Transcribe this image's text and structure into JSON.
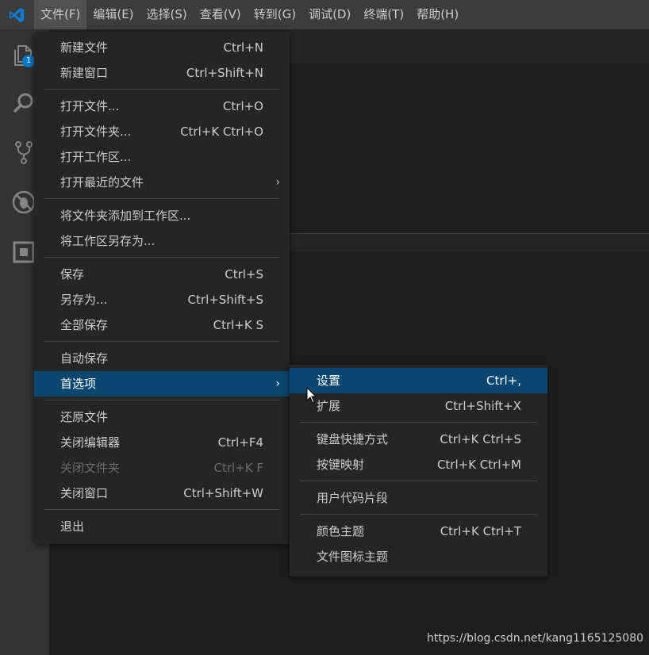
{
  "menubar": {
    "items": [
      "文件(F)",
      "编辑(E)",
      "选择(S)",
      "查看(V)",
      "转到(G)",
      "调试(D)",
      "终端(T)",
      "帮助(H)"
    ],
    "active_index": 0
  },
  "activitybar": {
    "icons": [
      "files-icon",
      "search-icon",
      "source-control-icon",
      "debug-icon",
      "extensions-icon"
    ],
    "badge": "1"
  },
  "file_menu": {
    "new_file": {
      "label": "新建文件",
      "shortcut": "Ctrl+N"
    },
    "new_window": {
      "label": "新建窗口",
      "shortcut": "Ctrl+Shift+N"
    },
    "open_file": {
      "label": "打开文件...",
      "shortcut": "Ctrl+O"
    },
    "open_folder": {
      "label": "打开文件夹...",
      "shortcut": "Ctrl+K Ctrl+O"
    },
    "open_workspace": {
      "label": "打开工作区..."
    },
    "open_recent": {
      "label": "打开最近的文件"
    },
    "add_folder": {
      "label": "将文件夹添加到工作区..."
    },
    "save_workspace_as": {
      "label": "将工作区另存为..."
    },
    "save": {
      "label": "保存",
      "shortcut": "Ctrl+S"
    },
    "save_as": {
      "label": "另存为...",
      "shortcut": "Ctrl+Shift+S"
    },
    "save_all": {
      "label": "全部保存",
      "shortcut": "Ctrl+K S"
    },
    "auto_save": {
      "label": "自动保存"
    },
    "preferences": {
      "label": "首选项"
    },
    "revert": {
      "label": "还原文件"
    },
    "close_editor": {
      "label": "关闭编辑器",
      "shortcut": "Ctrl+F4"
    },
    "close_folder": {
      "label": "关闭文件夹",
      "shortcut": "Ctrl+K F"
    },
    "close_window": {
      "label": "关闭窗口",
      "shortcut": "Ctrl+Shift+W"
    },
    "exit": {
      "label": "退出"
    }
  },
  "preferences_menu": {
    "settings": {
      "label": "设置",
      "shortcut": "Ctrl+,"
    },
    "extensions": {
      "label": "扩展",
      "shortcut": "Ctrl+Shift+X"
    },
    "keyboard_shortcuts": {
      "label": "键盘快捷方式",
      "shortcut": "Ctrl+K Ctrl+S"
    },
    "keymaps": {
      "label": "按键映射",
      "shortcut": "Ctrl+K Ctrl+M"
    },
    "user_snippets": {
      "label": "用户代码片段"
    },
    "color_theme": {
      "label": "颜色主题",
      "shortcut": "Ctrl+K Ctrl+T"
    },
    "file_icon_theme": {
      "label": "文件图标主题"
    }
  },
  "watermark": "https://blog.csdn.net/kang1165125080",
  "colors": {
    "highlight": "#094771",
    "titlebar": "#3c3c3c",
    "accent": "#007acc"
  }
}
